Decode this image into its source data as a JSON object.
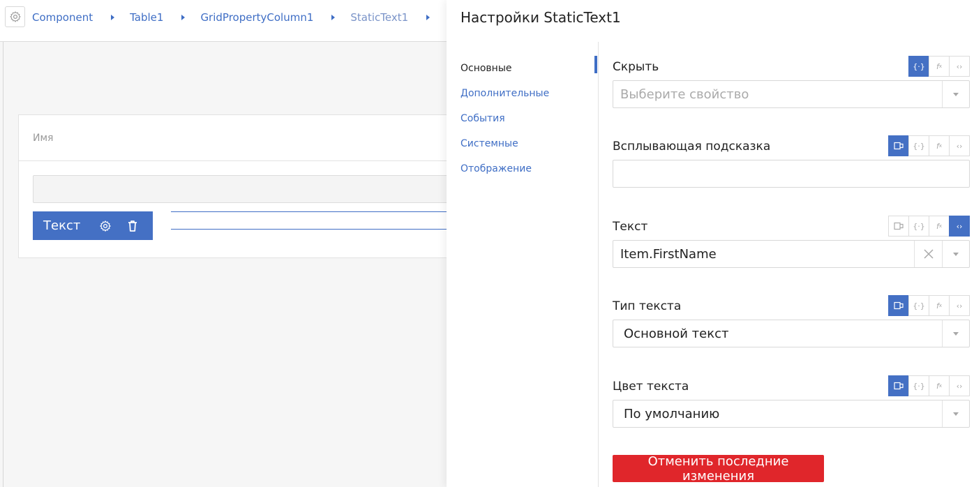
{
  "breadcrumb": {
    "items": [
      "Component",
      "Table1",
      "GridPropertyColumn1"
    ],
    "current": "StaticText1"
  },
  "canvas": {
    "column_header": "Имя",
    "selected_chip_label": "Текст"
  },
  "panel": {
    "title": "Настройки StaticText1",
    "nav": [
      "Основные",
      "Дополнительные",
      "События",
      "Системные",
      "Отображение"
    ],
    "active_nav": "Основные",
    "properties": [
      {
        "label": "Скрыть",
        "placeholder": "Выберите свойство",
        "value": "",
        "active_mode": "binding"
      },
      {
        "label": "Всплывающая подсказка",
        "value": "",
        "active_mode": "localize"
      },
      {
        "label": "Текст",
        "value": "Item.FirstName",
        "active_mode": "code"
      },
      {
        "label": "Тип текста",
        "value": "Основной текст",
        "active_mode": "localize"
      },
      {
        "label": "Цвет текста",
        "value": "По умолчанию",
        "active_mode": "localize"
      }
    ],
    "revert_button": "Отменить последние изменения"
  },
  "mode_icons": {
    "localize": "localize-icon",
    "binding": "binding-braces-icon",
    "formula": "fx-icon",
    "code": "code-brackets-icon"
  },
  "colors": {
    "accent": "#4470c4",
    "link": "#3f6ec5",
    "danger": "#e0262b"
  }
}
